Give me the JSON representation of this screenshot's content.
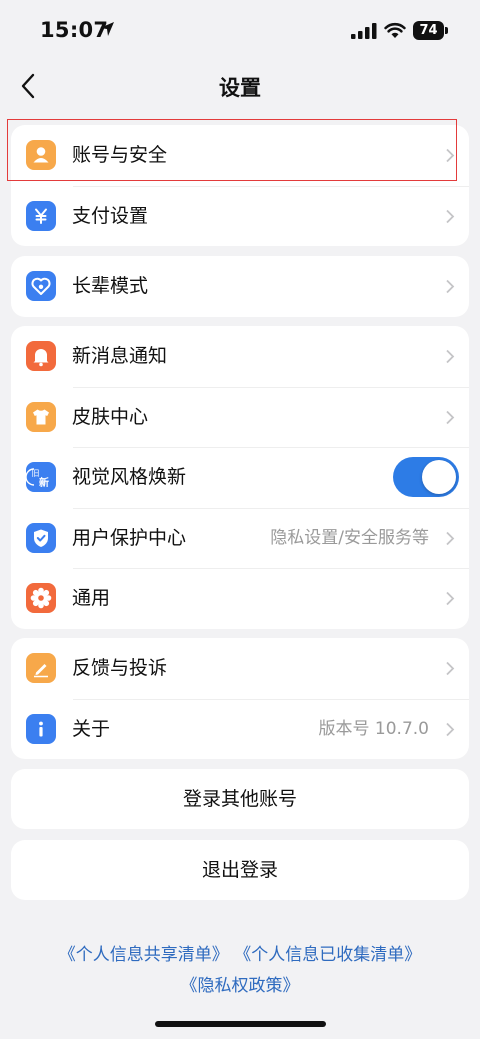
{
  "status_bar": {
    "time": "15:07",
    "battery": "74"
  },
  "nav": {
    "title": "设置"
  },
  "groups": [
    {
      "rows": [
        {
          "label": "账号与安全",
          "icon": "user-icon",
          "color": "#f7a84a"
        },
        {
          "label": "支付设置",
          "icon": "yuan-icon",
          "color": "#3b7ff0"
        }
      ]
    },
    {
      "rows": [
        {
          "label": "长辈模式",
          "icon": "elder-heart-icon",
          "color": "#3b7ff0"
        }
      ]
    },
    {
      "rows": [
        {
          "label": "新消息通知",
          "icon": "bell-icon",
          "color": "#f26a3c"
        },
        {
          "label": "皮肤中心",
          "icon": "tshirt-icon",
          "color": "#f7a84a"
        },
        {
          "label": "视觉风格焕新",
          "icon": "new-style-icon",
          "color": "#3b7ff0",
          "toggle_on": true,
          "icon_text_old": "旧",
          "icon_text_new": "新"
        },
        {
          "label": "用户保护中心",
          "icon": "shield-icon",
          "color": "#3b7ff0",
          "value": "隐私设置/安全服务等"
        },
        {
          "label": "通用",
          "icon": "gear-icon",
          "color": "#f26a3c"
        }
      ]
    },
    {
      "rows": [
        {
          "label": "反馈与投诉",
          "icon": "edit-icon",
          "color": "#f7a84a"
        },
        {
          "label": "关于",
          "icon": "info-icon",
          "color": "#3b7ff0",
          "value": "版本号 10.7.0"
        }
      ]
    }
  ],
  "actions": {
    "login_other": "登录其他账号",
    "logout": "退出登录"
  },
  "links": {
    "share_list": "《个人信息共享清单》",
    "collected_list": "《个人信息已收集清单》",
    "privacy_policy": "《隐私权政策》"
  },
  "colors": {
    "accent": "#2d7ce6",
    "highlight": "#e33b3b",
    "link": "#2f6bbf"
  }
}
